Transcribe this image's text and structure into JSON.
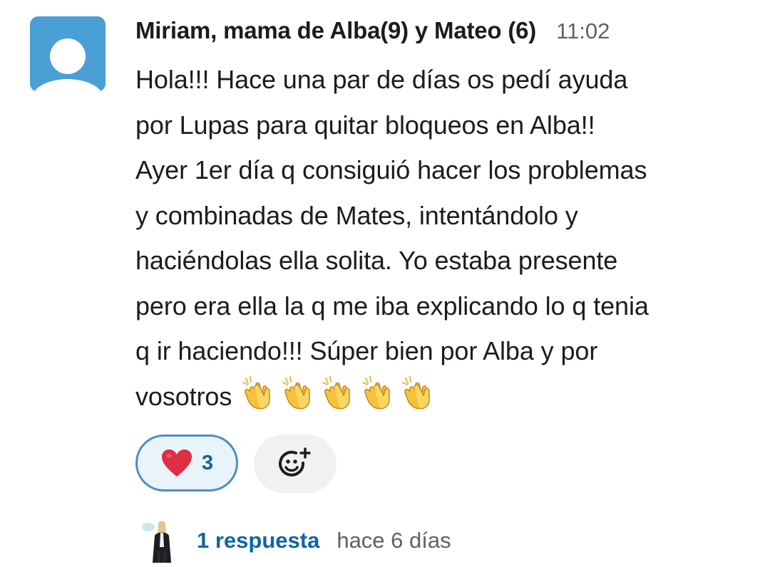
{
  "message": {
    "sender": "Miriam, mama de Alba(9) y Mateo (6)",
    "time": "11:02",
    "lines": [
      "Hola!!! Hace una par de días os pedí ayuda",
      "por Lupas para quitar bloqueos en Alba!!",
      "Ayer 1er día q consiguió hacer los problemas",
      "y combinadas de Mates, intentándolo y",
      "haciéndolas ella solita. Yo estaba presente",
      "pero era ella la q me iba explicando lo q tenia",
      "q ir haciendo!!! Súper bien por Alba y por",
      "vosotros"
    ],
    "emoji_icons": [
      "clapping-hands-icon",
      "clapping-hands-icon",
      "clapping-hands-icon",
      "clapping-hands-icon",
      "clapping-hands-icon"
    ]
  },
  "reactions": [
    {
      "icon": "red-heart-icon",
      "count": "3",
      "selected": true
    }
  ],
  "add_reaction": {
    "icon": "add-emoji-icon"
  },
  "thread": {
    "reply_label": "1 respuesta",
    "reply_time": "hace 6 días"
  },
  "colors": {
    "avatar_bg": "#4a9fd4",
    "link": "#1264a3",
    "reaction_border": "#4d8fbd",
    "reaction_bg": "#e8f3fa",
    "muted": "#616061"
  }
}
